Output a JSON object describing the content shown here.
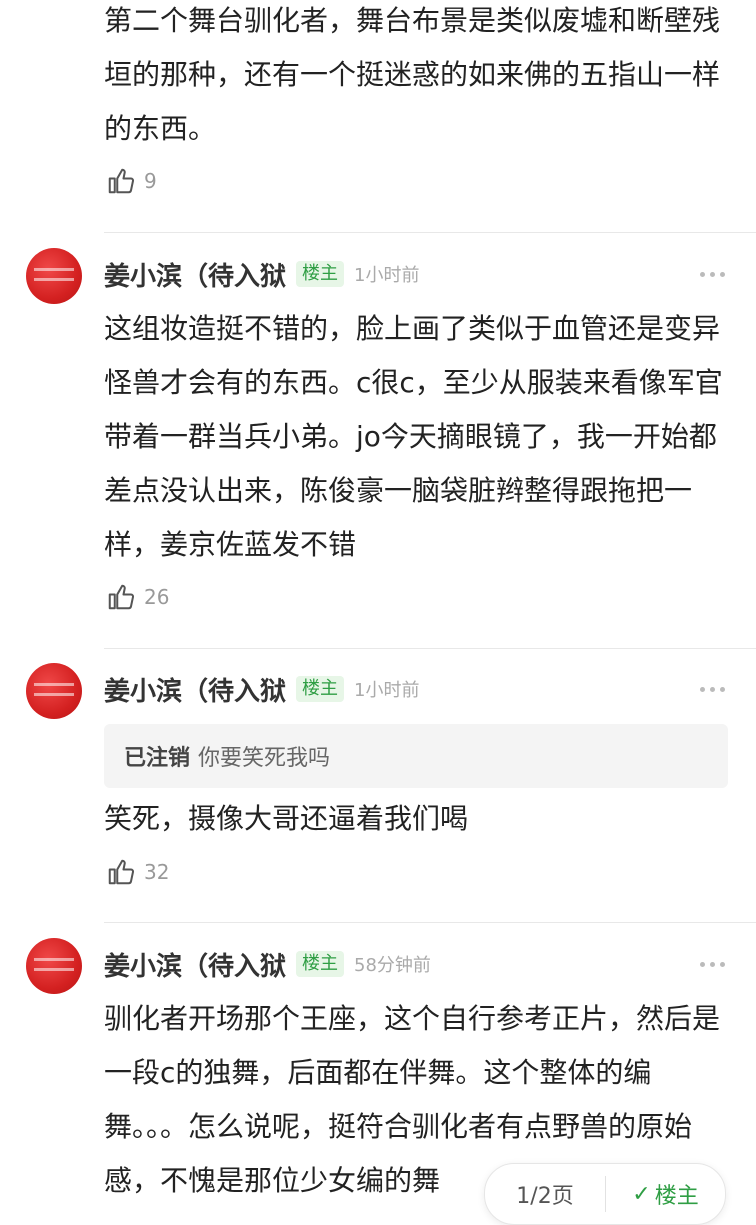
{
  "top_comment": {
    "text": "第二个舞台驯化者，舞台布景是类似废墟和断壁残垣的那种，还有一个挺迷惑的如来佛的五指山一样的东西。",
    "likes": "9"
  },
  "replies": [
    {
      "author": "姜小滨（待入狱",
      "badge": "楼主",
      "time": "1小时前",
      "text": "这组妆造挺不错的，脸上画了类似于血管还是变异怪兽才会有的东西。c很c，至少从服装来看像军官带着一群当兵小弟。jo今天摘眼镜了，我一开始都差点没认出来，陈俊豪一脑袋脏辫整得跟拖把一样，姜京佐蓝发不错",
      "likes": "26"
    },
    {
      "author": "姜小滨（待入狱",
      "badge": "楼主",
      "time": "1小时前",
      "quote_user": "已注销",
      "quote_text": "你要笑死我吗",
      "text": "笑死，摄像大哥还逼着我们喝",
      "likes": "32"
    },
    {
      "author": "姜小滨（待入狱",
      "badge": "楼主",
      "time": "58分钟前",
      "text": "驯化者开场那个王座，这个自行参考正片，然后是一段c的独舞，后面都在伴舞。这个整体的编舞。。。怎么说呢，挺符合驯化者有点野兽的原始感，不愧是那位少女编的舞"
    }
  ],
  "pager": {
    "page": "1/2页",
    "filter": "楼主"
  },
  "icons": {
    "like": "thumbs-up-icon",
    "more": "more-dots-icon",
    "check": "check-icon"
  }
}
